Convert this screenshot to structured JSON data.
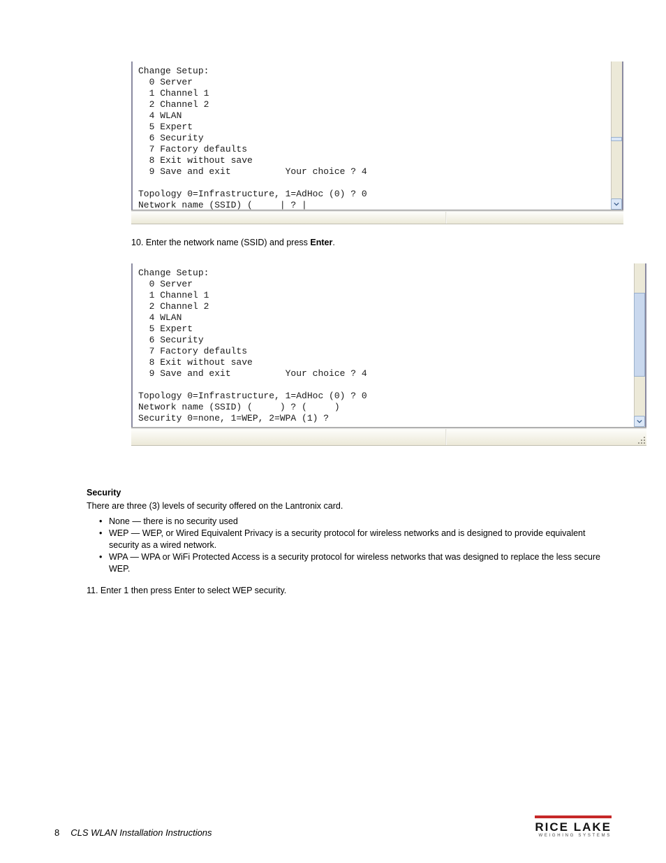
{
  "terminal1": {
    "lines": [
      "Change Setup:",
      "  0 Server",
      "  1 Channel 1",
      "  2 Channel 2",
      "  4 WLAN",
      "  5 Expert",
      "  6 Security",
      "  7 Factory defaults",
      "  8 Exit without save",
      "  9 Save and exit          Your choice ? 4",
      "",
      "Topology 0=Infrastructure, 1=AdHoc (0) ? 0",
      "Network name (SSID) (     | ? |"
    ]
  },
  "caption1": {
    "pre": "10. Enter the network name (SSID) and press ",
    "key": "Enter",
    "post": "."
  },
  "terminal2": {
    "lines": [
      "Change Setup:",
      "  0 Server",
      "  1 Channel 1",
      "  2 Channel 2",
      "  4 WLAN",
      "  5 Expert",
      "  6 Security",
      "  7 Factory defaults",
      "  8 Exit without save",
      "  9 Save and exit          Your choice ? 4",
      "",
      "Topology 0=Infrastructure, 1=AdHoc (0) ? 0",
      "Network name (SSID) (     ) ? (     )",
      "Security 0=none, 1=WEP, 2=WPA (1) ?"
    ]
  },
  "security": {
    "heading": "Security",
    "intro": "There are three (3) levels of security offered on the Lantronix card.",
    "bullets": [
      "None — there is no security used",
      "WEP — WEP, or Wired Equivalent Privacy is a security protocol for wireless networks and is designed to provide equivalent security as a wired network.",
      "WPA — WPA or WiFi Protected Access is a security protocol for wireless networks that was designed to replace the less secure WEP."
    ],
    "line_pre": "11. Enter ",
    "line_key1": "1",
    "line_mid": " then press ",
    "line_key2": "Enter",
    "line_post": " to select WEP security."
  },
  "footer": {
    "page": "8",
    "title": "CLS WLAN Installation Instructions",
    "logo_main": "RICE LAKE",
    "logo_sub": "WEIGHING SYSTEMS"
  }
}
